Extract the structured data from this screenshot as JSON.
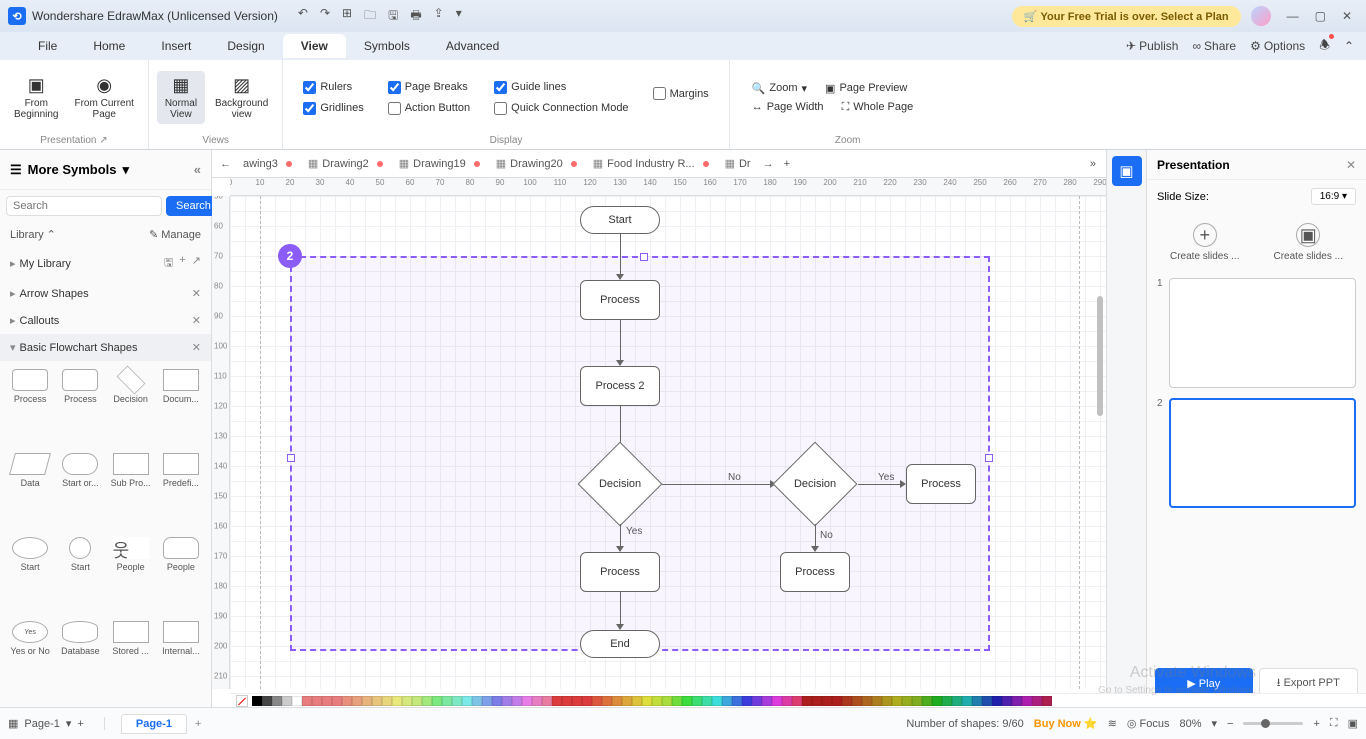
{
  "titlebar": {
    "appName": "Wondershare EdrawMax (Unlicensed Version)",
    "trialText": "Your Free Trial is over. Select a Plan"
  },
  "menu": {
    "items": [
      "File",
      "Home",
      "Insert",
      "Design",
      "View",
      "Symbols",
      "Advanced"
    ],
    "active": "View",
    "right": {
      "publish": "Publish",
      "share": "Share",
      "options": "Options"
    }
  },
  "ribbon": {
    "presentation": {
      "fromBeginning": "From\nBeginning",
      "fromCurrent": "From Current\nPage",
      "label": "Presentation"
    },
    "views": {
      "normal": "Normal\nView",
      "background": "Background\nview",
      "label": "Views"
    },
    "display": {
      "rulers": "Rulers",
      "pageBreaks": "Page Breaks",
      "guideLines": "Guide lines",
      "margins": "Margins",
      "gridlines": "Gridlines",
      "actionButton": "Action Button",
      "quickConn": "Quick Connection Mode",
      "label": "Display"
    },
    "zoom": {
      "zoom": "Zoom",
      "pagePreview": "Page Preview",
      "pageWidth": "Page Width",
      "wholePage": "Whole Page",
      "label": "Zoom"
    }
  },
  "leftpanel": {
    "title": "More Symbols",
    "searchPlaceholder": "Search",
    "searchBtn": "Search",
    "library": "Library",
    "manage": "Manage",
    "myLibrary": "My Library",
    "sections": [
      "Arrow Shapes",
      "Callouts"
    ],
    "expanded": "Basic Flowchart Shapes",
    "shapes": [
      "Process",
      "Process",
      "Decision",
      "Docum...",
      "Data",
      "Start or...",
      "Sub Pro...",
      "Predefi...",
      "Start",
      "Start",
      "People",
      "People",
      "Yes or No",
      "Database",
      "Stored ...",
      "Internal..."
    ]
  },
  "tabs": [
    {
      "label": "awing3",
      "dirty": true
    },
    {
      "label": "Drawing2",
      "dirty": true
    },
    {
      "label": "Drawing19",
      "dirty": true
    },
    {
      "label": "Drawing20",
      "dirty": true
    },
    {
      "label": "Food Industry R...",
      "dirty": true
    },
    {
      "label": "Dr",
      "dirty": false
    }
  ],
  "flowchart": {
    "start": "Start",
    "process": "Process",
    "process2": "Process 2",
    "decision": "Decision",
    "decision2": "Decision",
    "processR": "Process",
    "processB": "Process",
    "processB2": "Process",
    "end": "End",
    "yes": "Yes",
    "no": "No",
    "no2": "No",
    "yes2": "Yes"
  },
  "selectionBadge": "2",
  "presentation": {
    "title": "Presentation",
    "slideSize": "Slide Size:",
    "ratio": "16:9",
    "createSlides": "Create slides ...",
    "slides": [
      "1",
      "2"
    ],
    "play": "Play",
    "export": "Export PPT"
  },
  "status": {
    "page1": "Page-1",
    "pageTab": "Page-1",
    "shapes": "Number of shapes: 9/60",
    "buy": "Buy Now",
    "focus": "Focus",
    "zoom": "80%"
  },
  "watermark": {
    "title": "Activate Windows",
    "sub": "Go to Settings to activate Windows."
  }
}
